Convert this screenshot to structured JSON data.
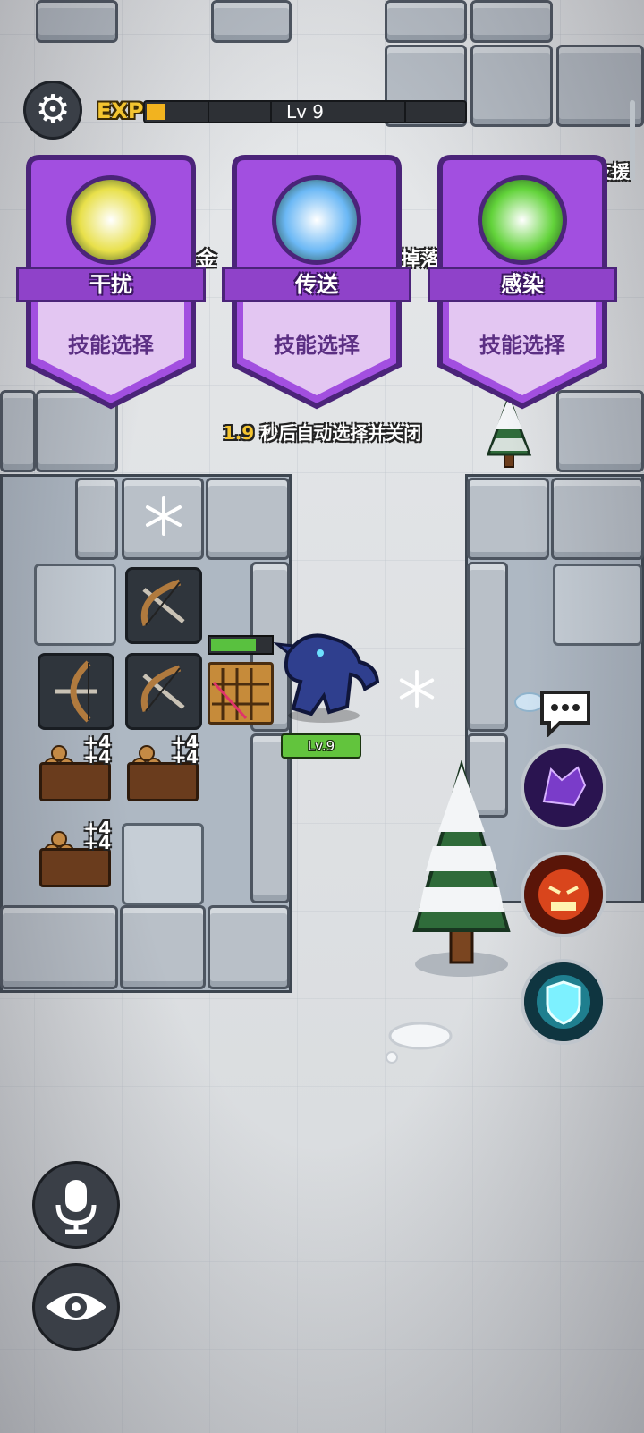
{
  "hud": {
    "exp_label": "EXP",
    "level_text": "Lv 9",
    "exp_progress": 0.06,
    "exp_segments": 8
  },
  "skill_cards": [
    {
      "name": "干扰",
      "action_label": "技能选择",
      "icon": "lightning-figure-icon",
      "orb_color": "#e8e04a"
    },
    {
      "name": "传送",
      "action_label": "技能选择",
      "icon": "teleport-burst-icon",
      "orb_color": "#6bb8f5"
    },
    {
      "name": "感染",
      "action_label": "技能选择",
      "icon": "infection-figure-icon",
      "orb_color": "#62d33a"
    }
  ],
  "timer": {
    "seconds": "1.9",
    "message": "秒后自动选择并关闭"
  },
  "background_text": {
    "left": "金",
    "right": "掉落",
    "top_right": "支援"
  },
  "board": {
    "crossbow_slots": 3,
    "wood_slots": [
      {
        "lines": [
          "+4",
          "+4"
        ]
      },
      {
        "lines": [
          "+4",
          "+4"
        ]
      },
      {
        "lines": [
          "+4",
          "+4"
        ]
      }
    ]
  },
  "enemy": {
    "level_badge": "Lv.9",
    "hp_fraction": 0.72
  },
  "abilities": [
    {
      "name": "wolf-howl-icon",
      "color": "#7a3cc9"
    },
    {
      "name": "rage-face-icon",
      "color": "#d9451c"
    },
    {
      "name": "shield-glow-icon",
      "color": "#41c7d9"
    }
  ],
  "controls": {
    "chat": "chat-bubble-icon",
    "mic": "microphone-icon",
    "eye": "eye-icon",
    "settings": "gear-icon"
  },
  "colors": {
    "card_purple": "#a24fe0",
    "card_light": "#e3c6f2",
    "exp_gold": "#f2b31f",
    "hp_green": "#59c13f"
  }
}
